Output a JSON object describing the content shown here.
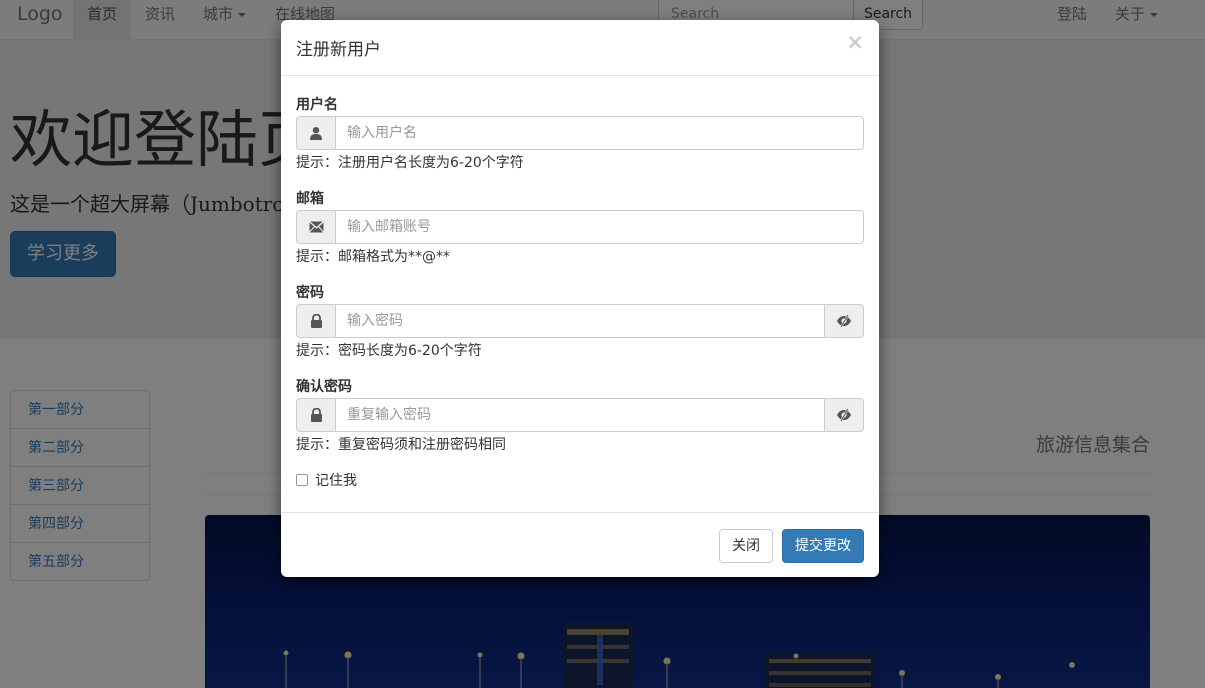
{
  "navbar": {
    "brand": "Logo",
    "items": [
      "首页",
      "资讯",
      "城市",
      "在线地图"
    ],
    "search_placeholder": "Search",
    "search_button": "Search",
    "right_items": [
      "登陆",
      "关于"
    ]
  },
  "jumbotron": {
    "title": "欢迎登陆页",
    "lead": "这是一个超大屏幕（Jumbotron",
    "button": "学习更多"
  },
  "side_list": {
    "items": [
      "第一部分",
      "第二部分",
      "第三部分",
      "第四部分",
      "第五部分"
    ]
  },
  "main": {
    "title": "旅游信息集合"
  },
  "modal": {
    "title": "注册新用户",
    "close_symbol": "×",
    "fields": [
      {
        "label": "用户名",
        "placeholder": "输入用户名",
        "help": "提示：注册用户名长度为6-20个字符",
        "icon": "user-icon"
      },
      {
        "label": "邮箱",
        "placeholder": "输入邮箱账号",
        "help": "提示：邮箱格式为**@**",
        "icon": "envelope-icon"
      },
      {
        "label": "密码",
        "placeholder": "输入密码",
        "help": "提示：密码长度为6-20个字符",
        "icon": "lock-icon",
        "toggle_icon": "eye-slash-icon"
      },
      {
        "label": "确认密码",
        "placeholder": "重复输入密码",
        "help": "提示：重复密码须和注册密码相同",
        "icon": "lock-icon",
        "toggle_icon": "eye-slash-icon"
      }
    ],
    "remember_label": "记住我",
    "close_button": "关闭",
    "submit_button": "提交更改"
  },
  "colors": {
    "primary": "#337ab7",
    "navbar_bg": "#f8f8f8",
    "jumbotron_bg": "#eeeeee",
    "backdrop": "rgba(0,0,0,0.5)"
  }
}
